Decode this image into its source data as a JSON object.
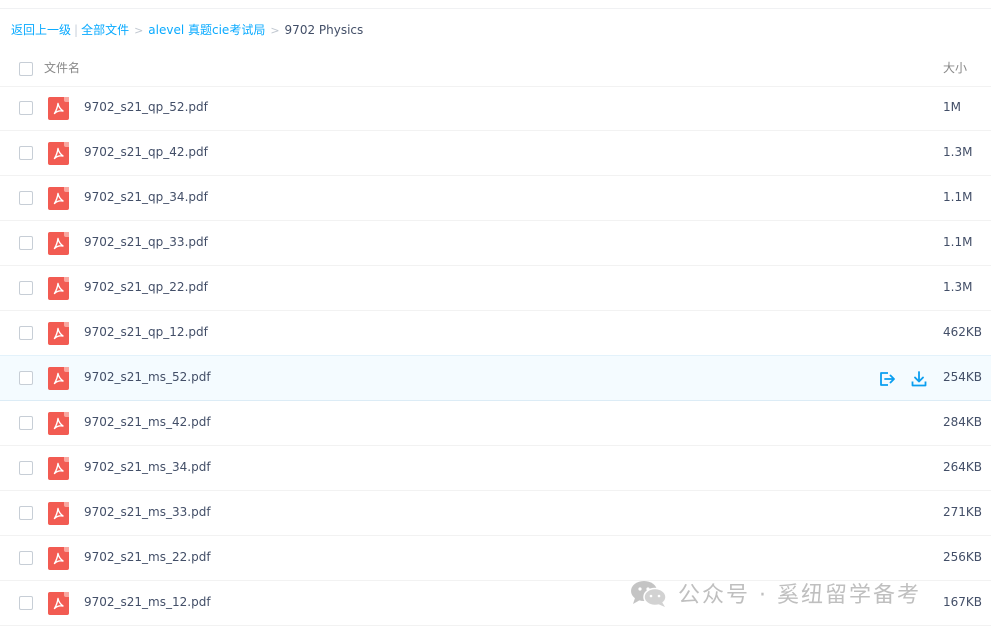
{
  "breadcrumb": {
    "back": "返回上一级",
    "separator": "|",
    "all_files": "全部文件",
    "folder": "alevel 真题cie考试局",
    "current": "9702 Physics",
    "gt": ">"
  },
  "header": {
    "name_label": "文件名",
    "size_label": "大小"
  },
  "files": [
    {
      "name": "9702_s21_qp_52.pdf",
      "size": "1M"
    },
    {
      "name": "9702_s21_qp_42.pdf",
      "size": "1.3M"
    },
    {
      "name": "9702_s21_qp_34.pdf",
      "size": "1.1M"
    },
    {
      "name": "9702_s21_qp_33.pdf",
      "size": "1.1M"
    },
    {
      "name": "9702_s21_qp_22.pdf",
      "size": "1.3M"
    },
    {
      "name": "9702_s21_qp_12.pdf",
      "size": "462KB"
    },
    {
      "name": "9702_s21_ms_52.pdf",
      "size": "254KB"
    },
    {
      "name": "9702_s21_ms_42.pdf",
      "size": "284KB"
    },
    {
      "name": "9702_s21_ms_34.pdf",
      "size": "264KB"
    },
    {
      "name": "9702_s21_ms_33.pdf",
      "size": "271KB"
    },
    {
      "name": "9702_s21_ms_22.pdf",
      "size": "256KB"
    },
    {
      "name": "9702_s21_ms_12.pdf",
      "size": "167KB"
    }
  ],
  "hovered_row_actions": [
    "share-icon",
    "download-icon"
  ],
  "watermark": {
    "text": "公众号 · 奚纽留学备考",
    "icon": "wechat-icon"
  },
  "colors": {
    "link": "#09aaff",
    "pdf_icon": "#f25b52",
    "hover_row": "#f4fbff",
    "text": "#424e67"
  }
}
